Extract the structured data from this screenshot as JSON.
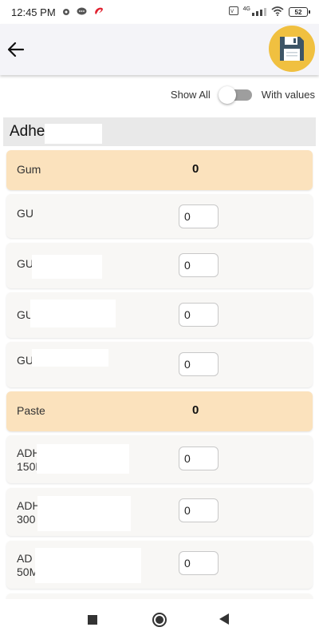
{
  "status_bar": {
    "time": "12:45 PM",
    "icons": [
      "gear-icon",
      "chat-icon",
      "airtel-icon",
      "volte-icon",
      "signal-icon",
      "wifi-icon"
    ],
    "network_label": "4G",
    "battery_level": "52"
  },
  "header": {
    "back_icon": "arrow-left-icon",
    "save_icon": "floppy-disk-icon"
  },
  "filter": {
    "left_label": "Show All",
    "right_label": "With values",
    "toggle_on": false
  },
  "section": {
    "title": "Adhe"
  },
  "groups": [
    {
      "label": "Gum",
      "total": "0",
      "items": [
        {
          "label": "GU",
          "value": "0"
        },
        {
          "label": "GU",
          "value": "0"
        },
        {
          "label": "GU",
          "value": "0"
        },
        {
          "label": "GU",
          "value": "0"
        }
      ]
    },
    {
      "label": "Paste",
      "total": "0",
      "items": [
        {
          "label": "ADH\n150M",
          "value": "0"
        },
        {
          "label": "ADH\n300",
          "value": "0"
        },
        {
          "label": "AD\n50M",
          "value": "0"
        }
      ]
    }
  ],
  "colors": {
    "group_row_bg": "#fbe2bd",
    "item_row_bg": "#f8f7f5",
    "save_button_bg": "#f0c040",
    "save_icon_color": "#3d5566"
  },
  "nav_bar": {
    "icons": [
      "recents-square-icon",
      "home-circle-icon",
      "back-triangle-icon"
    ]
  }
}
